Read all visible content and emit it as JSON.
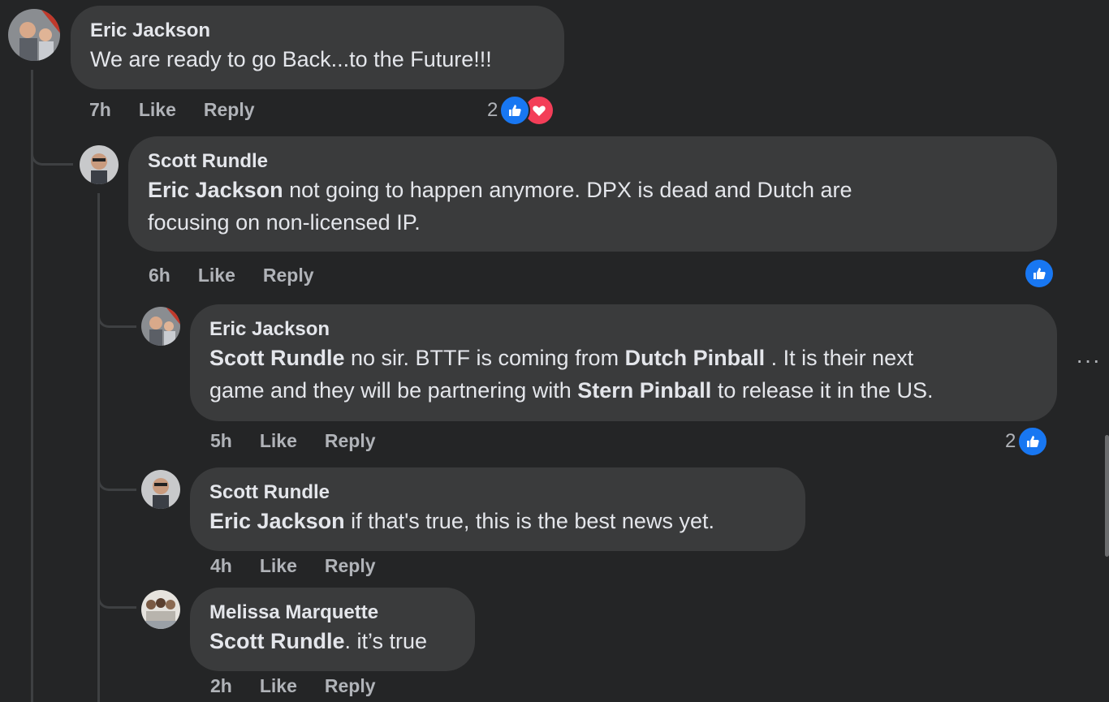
{
  "comments": [
    {
      "author": "Eric Jackson",
      "text": "We are ready to go Back...to the Future!!!",
      "time": "7h",
      "like": "Like",
      "reply": "Reply",
      "reaction_count": "2",
      "reactions": [
        "like",
        "love"
      ]
    },
    {
      "author": "Scott Rundle",
      "mention": "Eric Jackson",
      "text_line1": " not going to happen anymore. DPX is dead and Dutch are",
      "text_line2": "focusing on non-licensed IP.",
      "time": "6h",
      "like": "Like",
      "reply": "Reply",
      "reactions": [
        "like"
      ]
    },
    {
      "author": "Eric Jackson",
      "mention": "Scott Rundle",
      "text_a": " no sir. BTTF is coming from ",
      "mention2": "Dutch Pinball",
      "text_b": " . It is their next",
      "text_c": "game and they will be partnering with ",
      "mention3": "Stern Pinball",
      "text_d": " to release it in the US.",
      "time": "5h",
      "like": "Like",
      "reply": "Reply",
      "reaction_count": "2",
      "reactions": [
        "like"
      ],
      "more": "···"
    },
    {
      "author": "Scott Rundle",
      "mention": "Eric Jackson",
      "text": " if that's true, this is the best news yet.",
      "time": "4h",
      "like": "Like",
      "reply": "Reply"
    },
    {
      "author": "Melissa Marquette",
      "mention": "Scott Rundle",
      "text": ". it’s true",
      "time": "2h",
      "like": "Like",
      "reply": "Reply"
    }
  ],
  "colors": {
    "background": "#242526",
    "bubble": "#3a3b3c",
    "like_blue": "#1877f2",
    "love_red": "#f33e58"
  }
}
